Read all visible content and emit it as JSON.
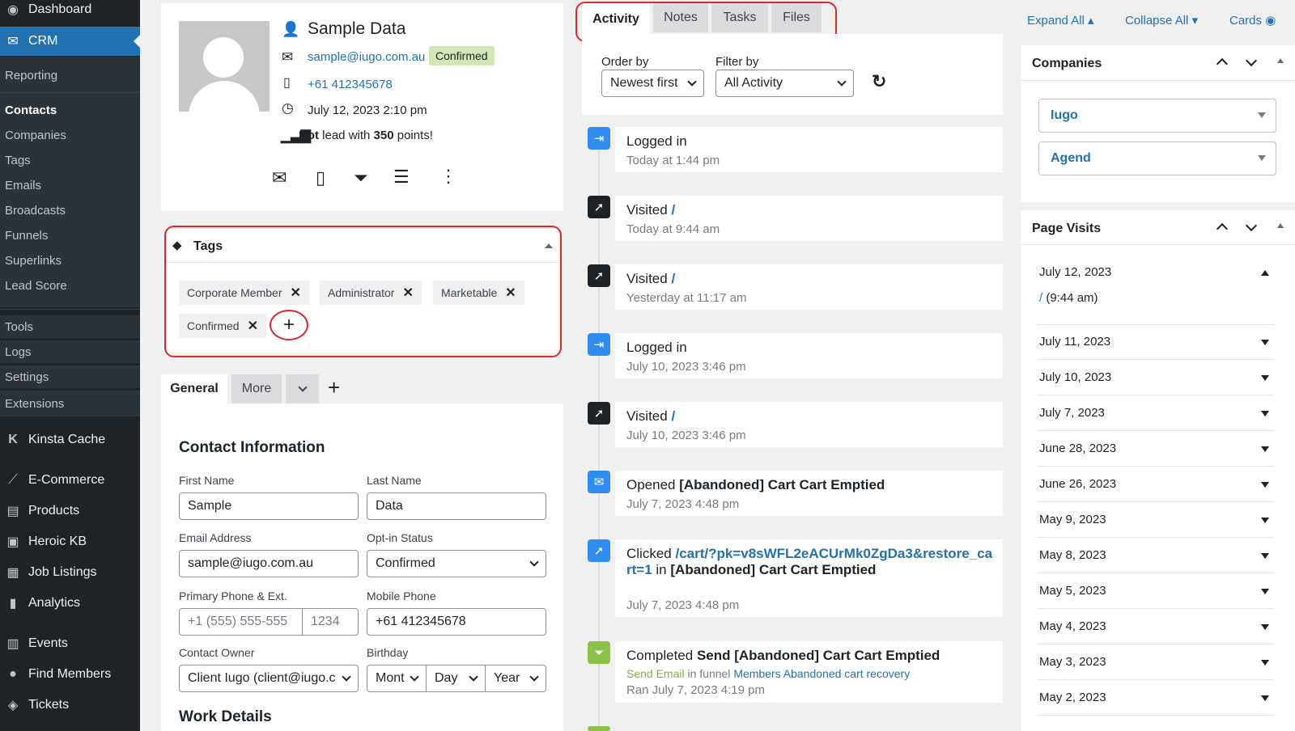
{
  "sidebar": {
    "dashboard": "Dashboard",
    "crm": "CRM",
    "sub_items": [
      "Reporting",
      "Contacts",
      "Companies",
      "Tags",
      "Emails",
      "Broadcasts",
      "Funnels",
      "Superlinks",
      "Lead Score",
      "Tools",
      "Logs",
      "Settings",
      "Extensions"
    ],
    "kinsta": "Kinsta Cache",
    "ecommerce": "E-Commerce",
    "products": "Products",
    "heroic": "Heroic KB",
    "jobs": "Job Listings",
    "analytics": "Analytics",
    "events": "Events",
    "members": "Find Members",
    "tickets": "Tickets"
  },
  "contact": {
    "name": "Sample Data",
    "email": "sample@iugo.com.au",
    "status": "Confirmed",
    "phone": "+61 412345678",
    "date": "July 12, 2023 2:10 pm",
    "lead_hot": "Hot",
    "lead_mid": " lead with ",
    "lead_points": "350",
    "lead_end": " points!"
  },
  "tags": {
    "title": "Tags",
    "items": [
      "Corporate Member",
      "Administrator",
      "Marketable",
      "Confirmed"
    ],
    "add": "+"
  },
  "info_tabs": {
    "general": "General",
    "more": "More",
    "add": "+"
  },
  "form": {
    "section_title": "Contact Information",
    "first_name_label": "First Name",
    "first_name": "Sample",
    "last_name_label": "Last Name",
    "last_name": "Data",
    "email_label": "Email Address",
    "email": "sample@iugo.com.au",
    "optin_label": "Opt-in Status",
    "optin": "Confirmed",
    "phone_label": "Primary Phone & Ext.",
    "phone_placeholder": "+1 (555) 555-555",
    "ext_placeholder": "1234",
    "mobile_label": "Mobile Phone",
    "mobile": "+61 412345678",
    "owner_label": "Contact Owner",
    "owner": "Client Iugo (client@iugo.c",
    "birthday_label": "Birthday",
    "month": "Mont",
    "day": "Day",
    "year": "Year",
    "work_title": "Work Details"
  },
  "activity_tabs": [
    "Activity",
    "Notes",
    "Tasks",
    "Files"
  ],
  "filters": {
    "order_label": "Order by",
    "order_value": "Newest first",
    "filter_label": "Filter by",
    "filter_value": "All Activity"
  },
  "activities": [
    {
      "title": "Logged in",
      "sub": "Today at 1:44 pm"
    },
    {
      "title": "Visited",
      "link": "/",
      "sub": "Today at 9:44 am"
    },
    {
      "title": "Visited",
      "link": "/",
      "sub": "Yesterday at 11:17 am"
    },
    {
      "title": "Logged in",
      "sub": "July 10, 2023 3:46 pm"
    },
    {
      "title": "Visited",
      "link": "/",
      "sub": "July 10, 2023 3:46 pm"
    },
    {
      "title": "Opened",
      "bold": "[Abandoned] Cart Cart Emptied",
      "sub": "July 7, 2023 4:48 pm"
    },
    {
      "title": "Clicked",
      "link": "/cart/?pk=v8sWFL2eACUrMk0ZgDa3&restore_cart=1",
      "mid": "in",
      "bold": "[Abandoned] Cart Cart Emptied",
      "sub": "July 7, 2023 4:48 pm"
    },
    {
      "title": "Completed",
      "bold": "Send [Abandoned] Cart Cart Emptied",
      "green": "Send Email",
      "in_funnel": "in funnel",
      "funnel": "Members Abandoned cart recovery",
      "sub": "Ran July 7, 2023 4:19 pm"
    }
  ],
  "right": {
    "expand": "Expand All",
    "collapse": "Collapse All",
    "cards": "Cards",
    "companies_title": "Companies",
    "companies": [
      "Iugo",
      "Agend"
    ],
    "visits_title": "Page Visits",
    "visit_open_date": "July 12, 2023",
    "visit_open_link": "/",
    "visit_open_time": "(9:44 am)",
    "visit_dates": [
      "July 11, 2023",
      "July 10, 2023",
      "July 7, 2023",
      "June 28, 2023",
      "June 26, 2023",
      "May 9, 2023",
      "May 8, 2023",
      "May 5, 2023",
      "May 4, 2023",
      "May 3, 2023",
      "May 2, 2023"
    ]
  }
}
